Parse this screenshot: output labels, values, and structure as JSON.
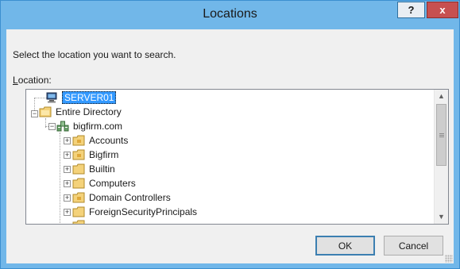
{
  "window": {
    "title": "Locations",
    "help_label": "?",
    "close_label": "x"
  },
  "dialog": {
    "prompt": "Select the location you want to search.",
    "location_accel": "L",
    "location_rest": "ocation:"
  },
  "tree": {
    "root": "SERVER01",
    "directory": "Entire Directory",
    "domain": "bigfirm.com",
    "ous": [
      "Accounts",
      "Bigfirm",
      "Builtin",
      "Computers",
      "Domain Controllers",
      "ForeignSecurityPrincipals"
    ]
  },
  "buttons": {
    "ok": "OK",
    "cancel": "Cancel"
  },
  "icons": {
    "computer": "computer-icon",
    "directory": "directory-icon",
    "domain": "domain-icon",
    "folder": "folder-icon"
  },
  "colors": {
    "titlebar": "#71b7e9",
    "selection": "#3399ff",
    "close": "#c75050"
  }
}
